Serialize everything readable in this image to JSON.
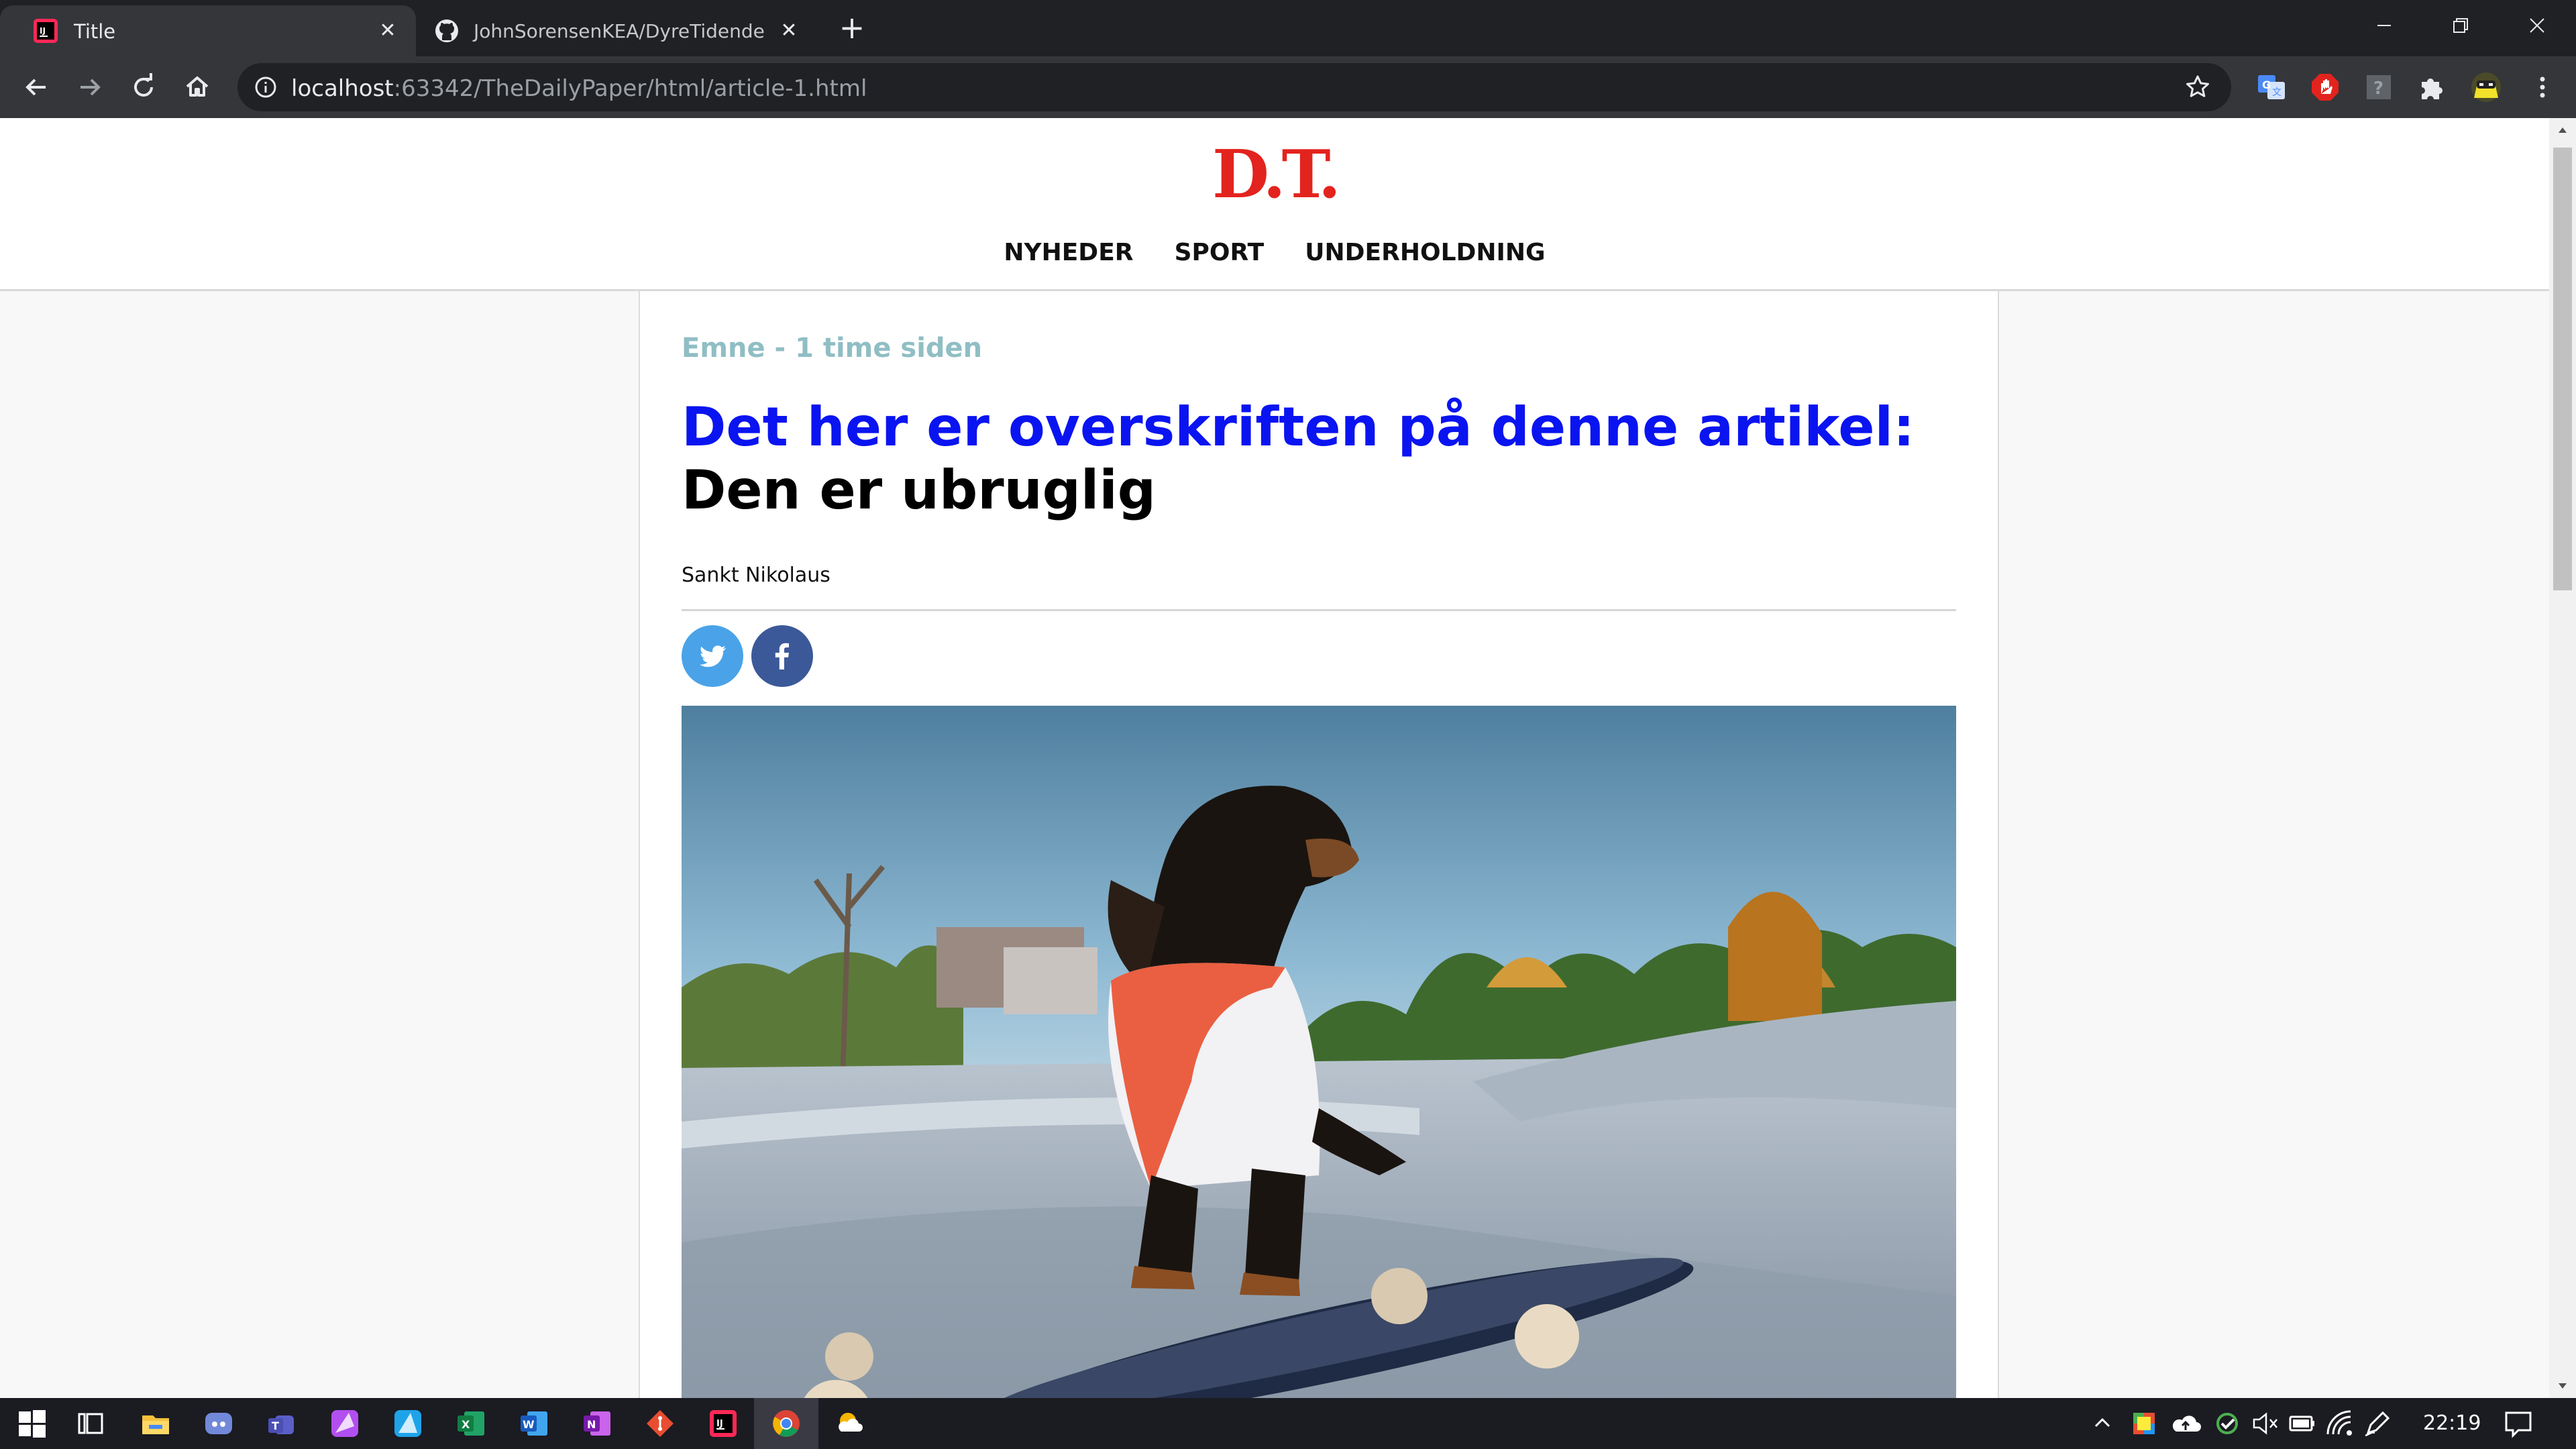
{
  "browser": {
    "tabs": [
      {
        "title": "Title",
        "favicon": "intellij-icon",
        "active": true
      },
      {
        "title": "JohnSorensenKEA/DyreTidende",
        "favicon": "github-icon",
        "active": false
      }
    ],
    "url_host": "localhost",
    "url_rest": ":63342/TheDailyPaper/html/article-1.html",
    "extensions": [
      "translate-icon",
      "adblock-icon",
      "help-icon",
      "puzzle-icon",
      "avatar-icon",
      "menu-icon"
    ]
  },
  "site": {
    "logo_text": "D.T.",
    "nav": [
      "NYHEDER",
      "SPORT",
      "UNDERHOLDNING"
    ]
  },
  "article": {
    "meta": "Emne - 1 time siden",
    "headline_blue": "Det her er overskriften på denne artikel:",
    "headline_black": "Den er ubruglig",
    "author": "Sankt Nikolaus",
    "share": [
      "twitter-icon",
      "facebook-icon"
    ],
    "image_subject": "dachshund-on-skateboard"
  },
  "colors": {
    "logo_red": "#e3231e",
    "meta": "#8fbec4",
    "headline_blue": "#0a14f0",
    "twitter": "#4aa3e8",
    "facebook": "#3b5998"
  },
  "taskbar": {
    "apps": [
      "windows-start-icon",
      "task-view-icon",
      "file-explorer-icon",
      "discord-icon",
      "teams-icon",
      "affinity-designer-icon",
      "affinity-photo-icon",
      "excel-icon",
      "word-icon",
      "onenote-icon",
      "git-icon",
      "intellij-icon",
      "chrome-icon",
      "weather-icon"
    ],
    "time": "22:19"
  }
}
